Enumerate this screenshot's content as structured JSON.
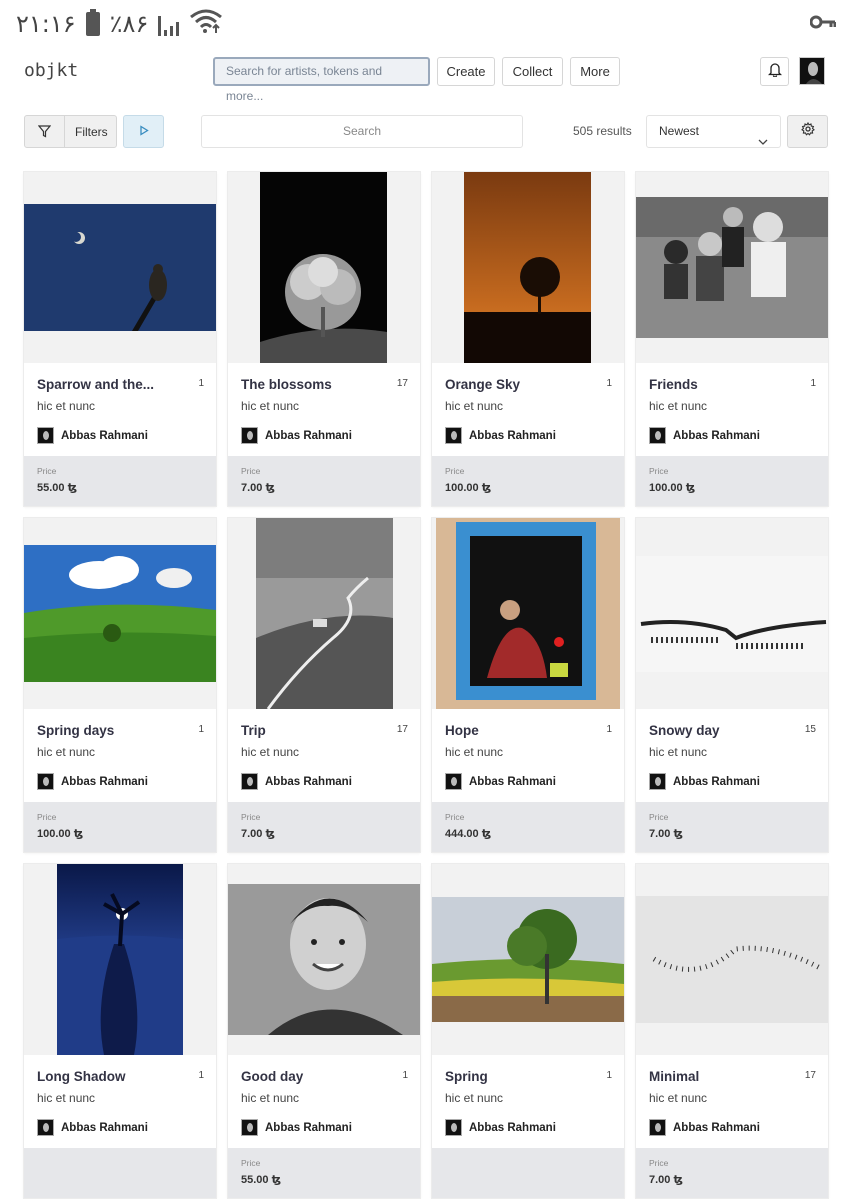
{
  "status_bar": {
    "time": "۲۱:۱۶",
    "battery": "٪۸۶"
  },
  "header": {
    "logo": "objkt",
    "search_placeholder": "Search for artists, tokens and more...",
    "create_label": "Create",
    "collect_label": "Collect",
    "more_label": "More"
  },
  "toolbar": {
    "filters_label": "Filters",
    "search_placeholder": "Search",
    "results": "505 results",
    "sort_value": "Newest"
  },
  "price_label": "Price",
  "tokens": [
    {
      "title": "Sparrow and the...",
      "editions": "1",
      "platform": "hic et nunc",
      "artist": "Abbas Rahmani",
      "price": "55.00 ꜩ"
    },
    {
      "title": "The blossoms",
      "editions": "17",
      "platform": "hic et nunc",
      "artist": "Abbas Rahmani",
      "price": "7.00 ꜩ"
    },
    {
      "title": "Orange Sky",
      "editions": "1",
      "platform": "hic et nunc",
      "artist": "Abbas Rahmani",
      "price": "100.00 ꜩ"
    },
    {
      "title": "Friends",
      "editions": "1",
      "platform": "hic et nunc",
      "artist": "Abbas Rahmani",
      "price": "100.00 ꜩ"
    },
    {
      "title": "Spring days",
      "editions": "1",
      "platform": "hic et nunc",
      "artist": "Abbas Rahmani",
      "price": "100.00 ꜩ"
    },
    {
      "title": "Trip",
      "editions": "17",
      "platform": "hic et nunc",
      "artist": "Abbas Rahmani",
      "price": "7.00 ꜩ"
    },
    {
      "title": "Hope",
      "editions": "1",
      "platform": "hic et nunc",
      "artist": "Abbas Rahmani",
      "price": "444.00 ꜩ"
    },
    {
      "title": "Snowy day",
      "editions": "15",
      "platform": "hic et nunc",
      "artist": "Abbas Rahmani",
      "price": "7.00 ꜩ"
    },
    {
      "title": "Long Shadow",
      "editions": "1",
      "platform": "hic et nunc",
      "artist": "Abbas Rahmani",
      "price": null
    },
    {
      "title": "Good day",
      "editions": "1",
      "platform": "hic et nunc",
      "artist": "Abbas Rahmani",
      "price": "55.00 ꜩ"
    },
    {
      "title": "Spring",
      "editions": "1",
      "platform": "hic et nunc",
      "artist": "Abbas Rahmani",
      "price": null
    },
    {
      "title": "Minimal",
      "editions": "17",
      "platform": "hic et nunc",
      "artist": "Abbas Rahmani",
      "price": "7.00 ꜩ"
    }
  ]
}
